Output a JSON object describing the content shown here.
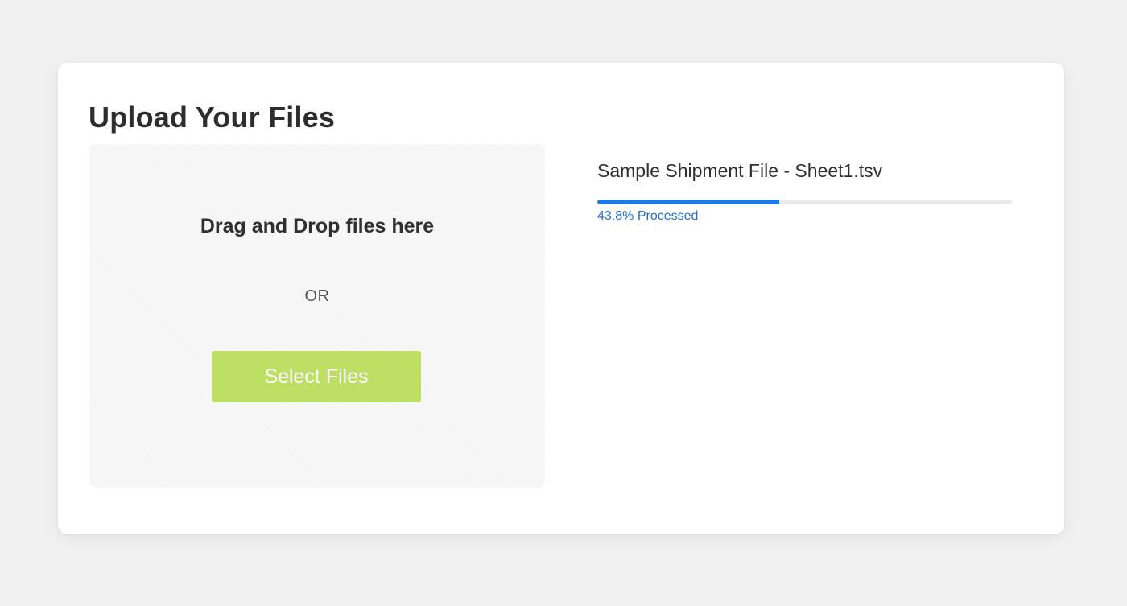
{
  "page": {
    "title": "Upload Your Files"
  },
  "dropzone": {
    "prompt": "Drag and Drop files here",
    "separator": "OR",
    "button_label": "Select Files",
    "button_color": "#bde064"
  },
  "upload": {
    "file_name": "Sample Shipment File - Sheet1.tsv",
    "progress_percent": 43.8,
    "progress_label": "43.8% Processed",
    "progress_color": "#1f7ae0"
  }
}
